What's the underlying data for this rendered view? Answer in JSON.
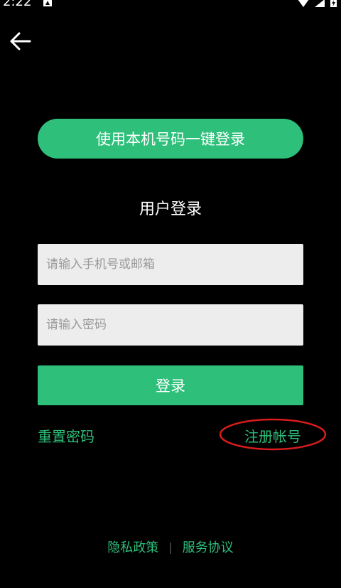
{
  "status_bar": {
    "time": "2:22"
  },
  "quick_login": {
    "label": "使用本机号码一键登录"
  },
  "login_form": {
    "title": "用户登录",
    "phone_placeholder": "请输入手机号或邮箱",
    "password_placeholder": "请输入密码",
    "login_label": "登录"
  },
  "links": {
    "reset_password": "重置密码",
    "register": "注册帐号"
  },
  "footer": {
    "privacy": "隐私政策",
    "divider": "|",
    "service": "服务协议"
  },
  "colors": {
    "background": "#000000",
    "accent": "#2ebf7a",
    "input_bg": "#ededed",
    "annotation": "#d81c1c"
  },
  "icons": {
    "back": "arrow-left-icon",
    "notification": "notification-icon",
    "wifi": "wifi-icon",
    "signal": "signal-icon",
    "battery": "battery-icon"
  }
}
